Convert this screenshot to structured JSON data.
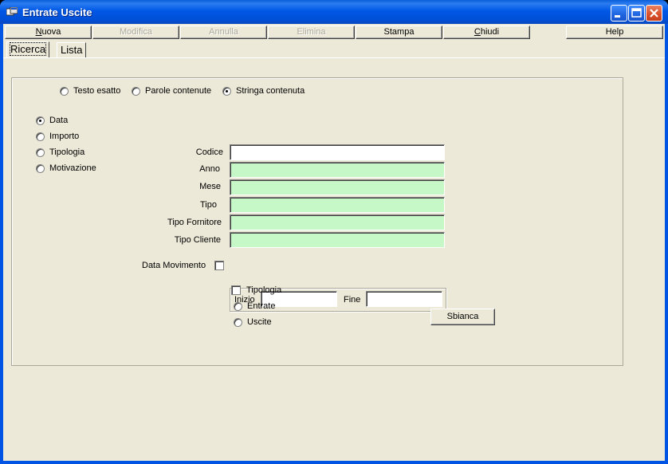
{
  "window": {
    "title": "Entrate Uscite"
  },
  "menu": [
    {
      "label": "Nuova",
      "underline": "N",
      "rest": "uova",
      "enabled": true
    },
    {
      "label": "Modifica",
      "enabled": false
    },
    {
      "label": "Annulla",
      "enabled": false
    },
    {
      "label": "Elimina",
      "enabled": false
    },
    {
      "label": "Stampa",
      "enabled": true
    },
    {
      "label": "Chiudi",
      "underline": "C",
      "rest": "hiudi",
      "enabled": true
    },
    {
      "label": "Help",
      "enabled": true
    }
  ],
  "tabs": [
    {
      "label": "Ricerca",
      "active": true
    },
    {
      "label": "Lista",
      "active": false
    }
  ],
  "search_mode": {
    "options": [
      "Testo esatto",
      "Parole contenute",
      "Stringa contenuta"
    ],
    "selected": "Stringa contenuta"
  },
  "order_by": {
    "options": [
      "Data",
      "Importo",
      "Tipologia",
      "Motivazione"
    ],
    "selected": "Data"
  },
  "fields": [
    {
      "label": "Codice",
      "value": "",
      "color": "#ffffff"
    },
    {
      "label": "Anno",
      "value": "",
      "color": "#c6f7c6"
    },
    {
      "label": "Mese",
      "value": "",
      "color": "#c6f7c6"
    },
    {
      "label": "Tipo",
      "value": "",
      "color": "#c6f7c6"
    },
    {
      "label": "Tipo Fornitore",
      "value": "",
      "color": "#c6f7c6"
    },
    {
      "label": "Tipo Cliente",
      "value": "",
      "color": "#c6f7c6"
    }
  ],
  "data_movimento": {
    "label": "Data Movimento",
    "checked": false,
    "inizio_label": "Inizio",
    "inizio_value": "",
    "fine_label": "Fine",
    "fine_value": ""
  },
  "tipologia": {
    "label": "Tipologia",
    "checked": false,
    "options": [
      "Entrate",
      "Uscite"
    ]
  },
  "sbianca_label": "Sbianca"
}
